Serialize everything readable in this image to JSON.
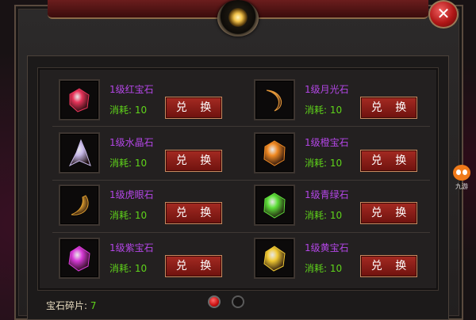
{
  "dialog": {
    "close_label": "✕"
  },
  "colors": {
    "name": "#b346e6",
    "cost": "#5fd41a",
    "button": "#8e1d17"
  },
  "gems": [
    {
      "name": "1级红宝石",
      "cost_label": "消耗: 10",
      "button": "兑 换",
      "icon": "red-gem-icon",
      "color": "#e8345a"
    },
    {
      "name": "1级月光石",
      "cost_label": "消耗: 10",
      "button": "兑 换",
      "icon": "moonstone-icon",
      "color": "#e89a3a"
    },
    {
      "name": "1级水晶石",
      "cost_label": "消耗: 10",
      "button": "兑 换",
      "icon": "crystal-icon",
      "color": "#c6b8e8"
    },
    {
      "name": "1级橙宝石",
      "cost_label": "消耗: 10",
      "button": "兑 换",
      "icon": "orange-gem-icon",
      "color": "#f08a24"
    },
    {
      "name": "1级虎眼石",
      "cost_label": "消耗: 10",
      "button": "兑 换",
      "icon": "tigers-eye-icon",
      "color": "#e0a030"
    },
    {
      "name": "1级青绿石",
      "cost_label": "消耗: 10",
      "button": "兑 换",
      "icon": "green-gem-icon",
      "color": "#5ee03a"
    },
    {
      "name": "1级紫宝石",
      "cost_label": "消耗: 10",
      "button": "兑 换",
      "icon": "purple-gem-icon",
      "color": "#d83ad8"
    },
    {
      "name": "1级黄宝石",
      "cost_label": "消耗: 10",
      "button": "兑 换",
      "icon": "yellow-gem-icon",
      "color": "#f0c832"
    }
  ],
  "footer": {
    "fragments_label": "宝石碎片: ",
    "fragments_value": "7",
    "page_current": 1,
    "page_total": 2
  },
  "mascot": {
    "label": "九游",
    "icon": "mascot-icon"
  }
}
